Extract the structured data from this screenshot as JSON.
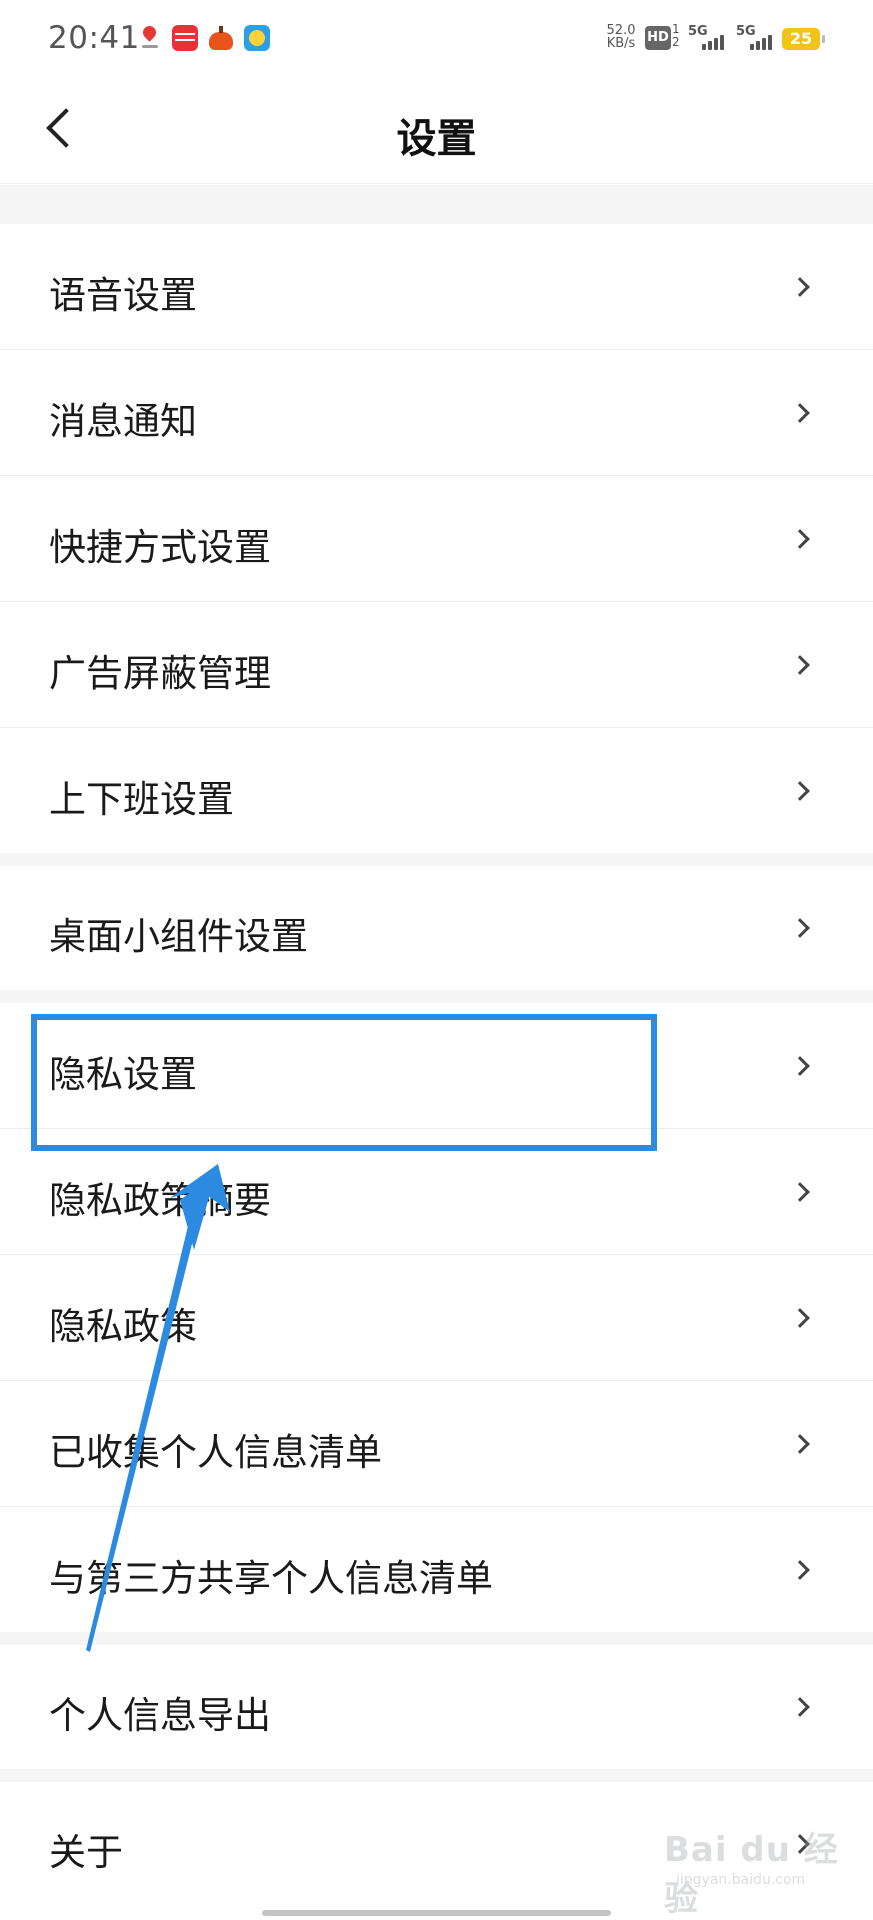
{
  "status_bar": {
    "time": "20:41",
    "net_speed_value": "52.0",
    "net_speed_unit": "KB/s",
    "hd_label": "HD",
    "sim_index": "1\n2",
    "signal1_label": "5G",
    "signal2_label": "5G",
    "battery_level": "25",
    "notification_icons": [
      "map-pin-icon",
      "red-app-icon",
      "orange-app-icon",
      "blue-app-icon"
    ]
  },
  "header": {
    "title": "设置",
    "back_icon": "chevron-left-icon"
  },
  "settings": {
    "items": [
      {
        "label": "语音设置"
      },
      {
        "label": "消息通知"
      },
      {
        "label": "快捷方式设置"
      },
      {
        "label": "广告屏蔽管理"
      },
      {
        "label": "上下班设置"
      },
      {
        "label": "桌面小组件设置"
      },
      {
        "label": "隐私设置"
      },
      {
        "label": "隐私政策摘要"
      },
      {
        "label": "隐私政策"
      },
      {
        "label": "已收集个人信息清单"
      },
      {
        "label": "与第三方共享个人信息清单"
      },
      {
        "label": "个人信息导出"
      },
      {
        "label": "关于"
      }
    ]
  },
  "annotation": {
    "highlight_color": "#2c8be0",
    "arrow_color": "#2c8be0"
  },
  "watermark": {
    "main": "Bai du 经验",
    "sub": "jingyan.baidu.com"
  }
}
